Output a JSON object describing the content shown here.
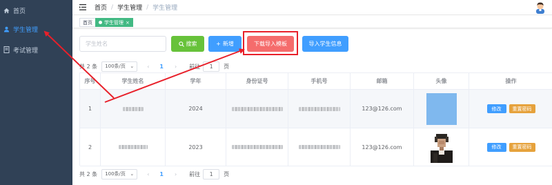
{
  "sidebar": {
    "items": [
      {
        "label": "首页",
        "icon": "home-icon",
        "active": false
      },
      {
        "label": "学生管理",
        "icon": "user-icon",
        "active": true
      },
      {
        "label": "考试管理",
        "icon": "document-icon",
        "active": false
      }
    ]
  },
  "navbar": {
    "breadcrumb": [
      "首页",
      "学生管理",
      "学生管理"
    ]
  },
  "tags": [
    {
      "label": "首页",
      "active": false
    },
    {
      "label": "学生管理",
      "active": true
    }
  ],
  "toolbar": {
    "search_placeholder": "学生姓名",
    "search_label": "搜索",
    "add_label": "新增",
    "download_template_label": "下载导入模板",
    "import_label": "导入学生信息"
  },
  "pagination": {
    "total_text": "共 2 条",
    "page_size": "100条/页",
    "current_page": "1",
    "goto_label": "前往",
    "page_suffix": "页",
    "jump_value": "1"
  },
  "table": {
    "columns": [
      "序号",
      "学生姓名",
      "学年",
      "身份证号",
      "手机号",
      "邮箱",
      "头像",
      "操作"
    ],
    "rows": [
      {
        "index": "1",
        "year": "2024",
        "email": "123@126.com",
        "photo": "blue-placeholder"
      },
      {
        "index": "2",
        "year": "2023",
        "email": "123@126.com",
        "photo": "pixelated-portrait"
      }
    ],
    "edit_label": "修改",
    "reset_label": "重置密码"
  },
  "colors": {
    "sidebar_bg": "#304156",
    "active": "#409eff",
    "search_btn": "#67c23a",
    "template_btn": "#f56c6c",
    "reset_btn": "#e6a23c",
    "annotation": "#e8202a"
  }
}
